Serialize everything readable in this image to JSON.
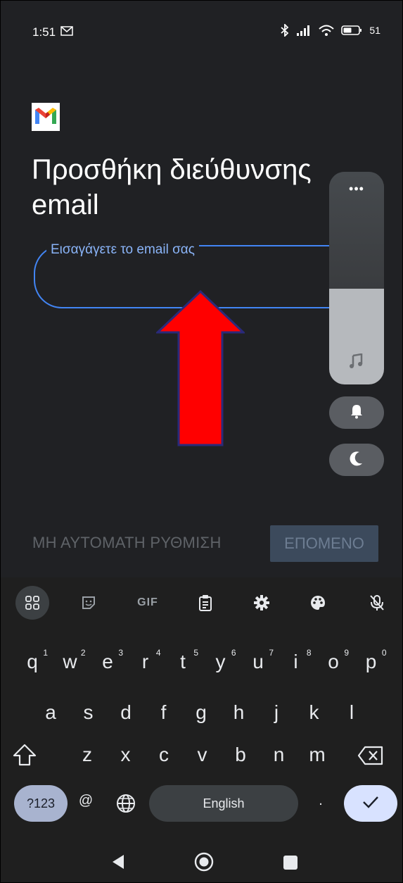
{
  "status_bar": {
    "time": "1:51",
    "battery": "51"
  },
  "title": "Προσθήκη διεύθυνσης\nemail",
  "email": {
    "label": "Εισαγάγετε το email σας",
    "value": ""
  },
  "volume": {
    "dots": "•••",
    "level_percent": 45
  },
  "actions": {
    "manual_setup": "ΜΗ ΑΥΤΟΜΑΤΗ ΡΥΘΜΙΣΗ",
    "next": "ΕΠΟΜΕΝΟ"
  },
  "keyboard": {
    "toolbar": [
      "apps-grid-icon",
      "sticker-icon",
      "gif",
      "clipboard-icon",
      "settings-icon",
      "palette-icon",
      "mic-off-icon"
    ],
    "gif_label": "GIF",
    "row1": [
      {
        "k": "q",
        "n": "1"
      },
      {
        "k": "w",
        "n": "2"
      },
      {
        "k": "e",
        "n": "3"
      },
      {
        "k": "r",
        "n": "4"
      },
      {
        "k": "t",
        "n": "5"
      },
      {
        "k": "y",
        "n": "6"
      },
      {
        "k": "u",
        "n": "7"
      },
      {
        "k": "i",
        "n": "8"
      },
      {
        "k": "o",
        "n": "9"
      },
      {
        "k": "p",
        "n": "0"
      }
    ],
    "row2": [
      "a",
      "s",
      "d",
      "f",
      "g",
      "h",
      "j",
      "k",
      "l"
    ],
    "row3": [
      "z",
      "x",
      "c",
      "v",
      "b",
      "n",
      "m"
    ],
    "symbols_label": "?123",
    "at_label": "@",
    "space_label": "English",
    "period_label": "."
  },
  "colors": {
    "accent": "#4285f4",
    "label": "#8ab4f8",
    "arrow": "#ff0000"
  }
}
